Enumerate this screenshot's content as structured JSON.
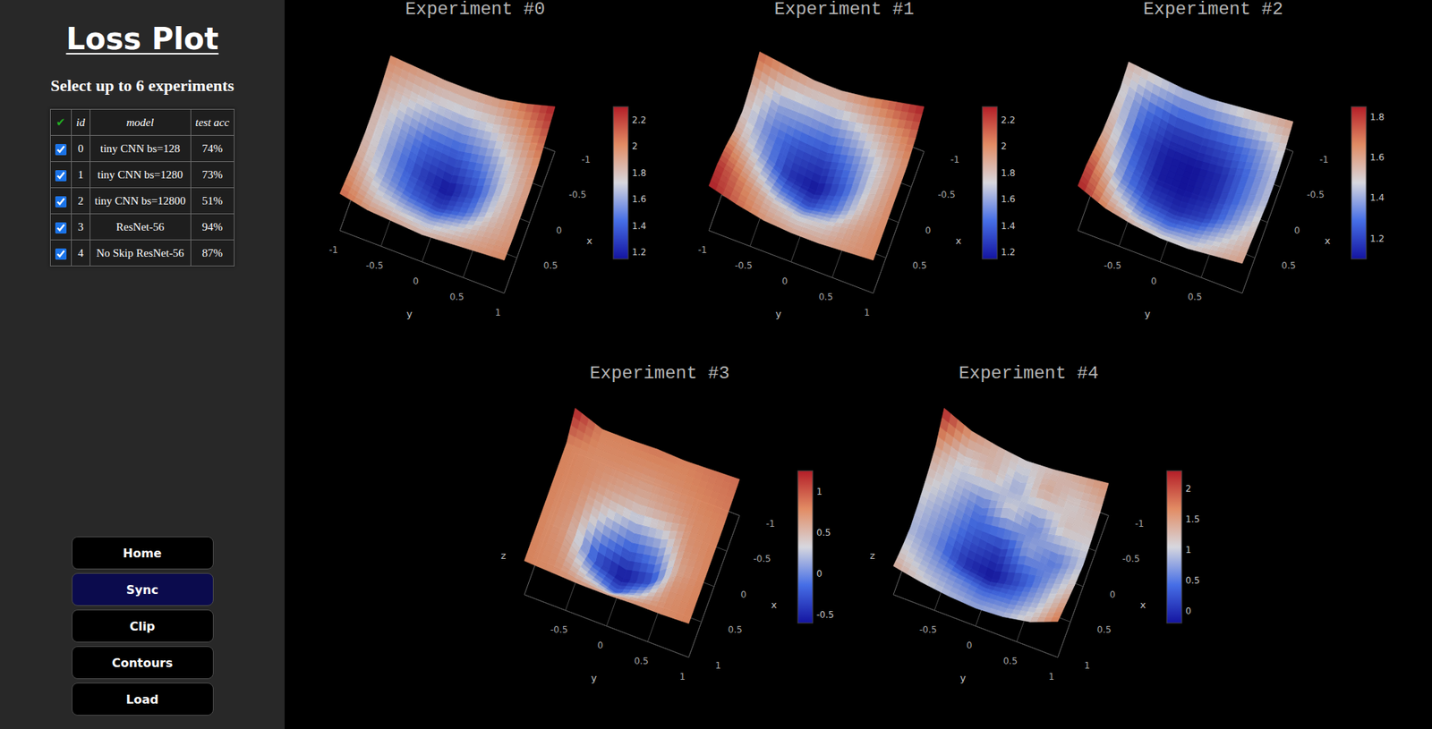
{
  "app": {
    "title": "Loss Plot",
    "subtitle": "Select up to 6 experiments"
  },
  "table": {
    "columns": [
      "✔",
      "id",
      "model",
      "test acc"
    ],
    "rows": [
      {
        "checked": true,
        "id": "0",
        "model": "tiny CNN bs=128",
        "test_acc": "74%"
      },
      {
        "checked": true,
        "id": "1",
        "model": "tiny CNN bs=1280",
        "test_acc": "73%"
      },
      {
        "checked": true,
        "id": "2",
        "model": "tiny CNN bs=12800",
        "test_acc": "51%"
      },
      {
        "checked": true,
        "id": "3",
        "model": "ResNet-56",
        "test_acc": "94%"
      },
      {
        "checked": true,
        "id": "4",
        "model": "No Skip ResNet-56",
        "test_acc": "87%"
      }
    ]
  },
  "buttons": [
    {
      "label": "Home",
      "selected": false
    },
    {
      "label": "Sync",
      "selected": true
    },
    {
      "label": "Clip",
      "selected": false
    },
    {
      "label": "Contours",
      "selected": false
    },
    {
      "label": "Load",
      "selected": false
    }
  ],
  "experiments": [
    {
      "title": "Experiment #0",
      "axis_titles": [
        "x",
        "y"
      ],
      "x_ticks": [
        "-1",
        "-0.5",
        "0",
        "0.5"
      ],
      "y_ticks": [
        "-1",
        "-0.5",
        "0",
        "0.5",
        "1"
      ],
      "colorbar_ticks": [
        "2.2",
        "2",
        "1.8",
        "1.6",
        "1.4",
        "1.2"
      ],
      "z": [
        [
          2.0,
          1.95,
          1.9,
          1.9,
          1.95,
          2.1,
          2.3
        ],
        [
          1.9,
          1.75,
          1.65,
          1.6,
          1.7,
          1.9,
          2.15
        ],
        [
          1.85,
          1.6,
          1.4,
          1.35,
          1.5,
          1.75,
          2.0
        ],
        [
          1.85,
          1.55,
          1.3,
          1.15,
          1.35,
          1.7,
          1.95
        ],
        [
          1.9,
          1.6,
          1.4,
          1.3,
          1.45,
          1.75,
          1.95
        ],
        [
          2.0,
          1.75,
          1.65,
          1.6,
          1.7,
          1.85,
          1.95
        ],
        [
          2.1,
          1.95,
          1.9,
          1.85,
          1.9,
          1.95,
          2.0
        ]
      ]
    },
    {
      "title": "Experiment #1",
      "axis_titles": [
        "x",
        "y"
      ],
      "x_ticks": [
        "-1",
        "-0.5",
        "0",
        "0.5"
      ],
      "y_ticks": [
        "-1",
        "-0.5",
        "0",
        "0.5",
        "1"
      ],
      "colorbar_ticks": [
        "2.2",
        "2",
        "1.8",
        "1.6",
        "1.4",
        "1.2"
      ],
      "z": [
        [
          2.1,
          2.0,
          1.9,
          1.9,
          2.0,
          2.15,
          2.3
        ],
        [
          1.9,
          1.6,
          1.6,
          1.55,
          1.7,
          1.9,
          2.1
        ],
        [
          1.8,
          1.5,
          1.35,
          1.3,
          1.5,
          1.75,
          2.0
        ],
        [
          1.9,
          1.6,
          1.25,
          1.15,
          1.4,
          1.75,
          2.0
        ],
        [
          2.1,
          1.8,
          1.5,
          1.35,
          1.5,
          1.8,
          2.0
        ],
        [
          2.25,
          2.0,
          1.8,
          1.7,
          1.75,
          1.9,
          2.0
        ],
        [
          2.3,
          2.1,
          1.95,
          1.9,
          1.9,
          1.95,
          2.0
        ]
      ]
    },
    {
      "title": "Experiment #2",
      "axis_titles": [
        "x",
        "y"
      ],
      "x_ticks": [
        "-1",
        "-0.5",
        "0",
        "0.5"
      ],
      "y_ticks": [
        "-0.5",
        "0",
        "0.5"
      ],
      "colorbar_ticks": [
        "1.8",
        "1.6",
        "1.4",
        "1.2"
      ],
      "z": [
        [
          1.55,
          1.5,
          1.45,
          1.45,
          1.5,
          1.55,
          1.6
        ],
        [
          1.5,
          1.3,
          1.2,
          1.2,
          1.25,
          1.35,
          1.5
        ],
        [
          1.55,
          1.25,
          1.12,
          1.1,
          1.15,
          1.3,
          1.45
        ],
        [
          1.6,
          1.3,
          1.12,
          1.1,
          1.15,
          1.3,
          1.45
        ],
        [
          1.7,
          1.35,
          1.2,
          1.15,
          1.2,
          1.35,
          1.5
        ],
        [
          1.8,
          1.5,
          1.35,
          1.3,
          1.35,
          1.45,
          1.55
        ],
        [
          1.85,
          1.65,
          1.55,
          1.5,
          1.5,
          1.55,
          1.6
        ]
      ]
    },
    {
      "title": "Experiment #3",
      "axis_titles": [
        "x",
        "y",
        "z"
      ],
      "x_ticks": [
        "-1",
        "-0.5",
        "0",
        "0.5",
        "1"
      ],
      "y_ticks": [
        "-0.5",
        "0",
        "0.5",
        "1"
      ],
      "colorbar_ticks": [
        "1",
        "0.5",
        "0",
        "-0.5"
      ],
      "z": [
        [
          1.25,
          0.8,
          0.8,
          0.85,
          0.8,
          0.85,
          0.9
        ],
        [
          0.8,
          0.75,
          0.75,
          0.7,
          0.75,
          0.8,
          0.85
        ],
        [
          0.8,
          0.75,
          0.6,
          0.5,
          0.6,
          0.75,
          0.8
        ],
        [
          0.8,
          0.7,
          0.2,
          -0.1,
          0.1,
          0.7,
          0.8
        ],
        [
          0.8,
          0.65,
          -0.3,
          -0.6,
          -0.3,
          0.6,
          0.8
        ],
        [
          0.8,
          0.7,
          0.2,
          -0.2,
          0.2,
          0.7,
          0.8
        ],
        [
          0.8,
          0.75,
          0.7,
          0.7,
          0.75,
          0.75,
          0.8
        ]
      ]
    },
    {
      "title": "Experiment #4",
      "axis_titles": [
        "x",
        "y",
        "z"
      ],
      "x_ticks": [
        "-1",
        "-0.5",
        "0",
        "0.5",
        "1"
      ],
      "y_ticks": [
        "-0.5",
        "0",
        "0.5",
        "1"
      ],
      "colorbar_ticks": [
        "2",
        "1.5",
        "1",
        "0.5",
        "0"
      ],
      "z": [
        [
          2.3,
          1.6,
          1.3,
          1.1,
          1.2,
          1.4,
          1.6
        ],
        [
          1.5,
          1.0,
          1.3,
          0.8,
          1.4,
          1.1,
          1.3
        ],
        [
          1.2,
          0.9,
          0.5,
          1.1,
          0.6,
          1.2,
          1.1
        ],
        [
          1.0,
          0.7,
          0.3,
          0.1,
          0.8,
          0.5,
          1.0
        ],
        [
          0.9,
          0.6,
          0.0,
          -0.2,
          0.2,
          0.7,
          1.2
        ],
        [
          1.1,
          0.8,
          0.6,
          0.4,
          0.5,
          0.9,
          1.5
        ],
        [
          1.4,
          1.1,
          0.9,
          0.8,
          0.9,
          1.2,
          1.8
        ]
      ]
    }
  ]
}
